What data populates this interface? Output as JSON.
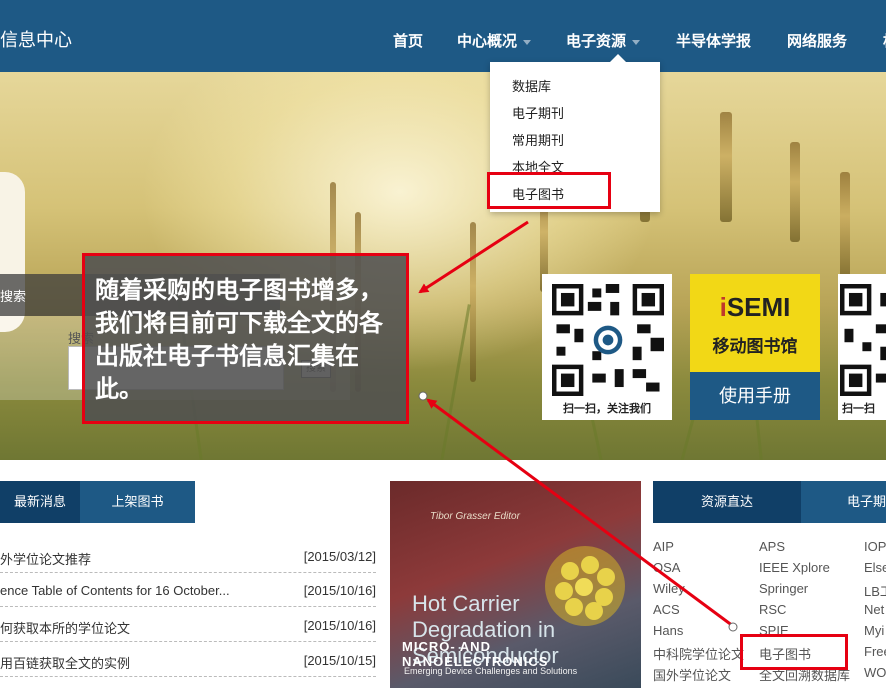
{
  "header": {
    "site_title": "信息中心",
    "nav": [
      {
        "label": "首页"
      },
      {
        "label": "中心概况"
      },
      {
        "label": "电子资源"
      },
      {
        "label": "半导体学报"
      },
      {
        "label": "网络服务"
      },
      {
        "label": "松"
      }
    ]
  },
  "dropdown": {
    "items": [
      "数据库",
      "电子期刊",
      "常用期刊",
      "本地全文",
      "电子图书"
    ],
    "highlighted": "电子图书"
  },
  "search": {
    "tab_label": "搜索",
    "hint": "搜索",
    "button_label": "搜索"
  },
  "callout": {
    "text": "随着采购的电子图书增多，我们将目前可下载全文的各出版社电子书信息汇集在此。"
  },
  "qr_cards": [
    {
      "caption": "扫一扫，关注我们"
    },
    {
      "caption": "扫一扫"
    }
  ],
  "isemi": {
    "logo_i": "i",
    "logo_rest": "SEMI",
    "subtitle": "移动图书馆",
    "manual": "使用手册"
  },
  "news": {
    "tabs": [
      "最新消息",
      "上架图书"
    ],
    "rows": [
      {
        "title": "外学位论文推荐",
        "date": "[2015/03/12]"
      },
      {
        "title": "ence Table of Contents for 16 October...",
        "date": "[2015/10/16]"
      },
      {
        "title": "何获取本所的学位论文",
        "date": "[2015/10/16]"
      },
      {
        "title": "用百链获取全文的实例",
        "date": "[2015/10/15]"
      }
    ]
  },
  "book": {
    "author": "Tibor Grasser Editor",
    "title": "Hot Carrier Degradation in Semiconductor",
    "series": "MICRO- AND NANOELECTRONICS",
    "subtitle": "Emerging Device Challenges and Solutions"
  },
  "resources": {
    "tabs": [
      "资源直达",
      "电子期"
    ],
    "columns": [
      [
        "AIP",
        "OSA",
        "Wiley",
        "ACS",
        "Hans",
        "中科院学位论文",
        "国外学位论文"
      ],
      [
        "APS",
        "IEEE Xplore",
        "Springer",
        "RSC",
        "SPIE",
        "电子图书",
        "全文回溯数据库"
      ],
      [
        "IOP",
        "Else",
        "LB工",
        "Net",
        "Myi",
        "Free",
        "WO"
      ]
    ],
    "highlighted": "电子图书"
  },
  "colors": {
    "header_bg": "#1e5985",
    "accent_red": "#e60012",
    "tab_dark": "#103f67",
    "tab_blue": "#1e5985"
  }
}
